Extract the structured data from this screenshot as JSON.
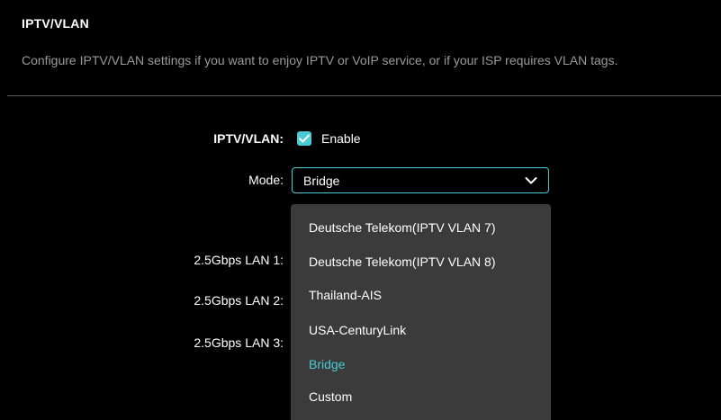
{
  "section": {
    "title": "IPTV/VLAN",
    "description": "Configure IPTV/VLAN settings if you want to enjoy IPTV or VoIP service, or if your ISP requires VLAN tags."
  },
  "form": {
    "iptv_label": "IPTV/VLAN:",
    "enable_label": "Enable",
    "enable_checked": true,
    "mode_label": "Mode:",
    "mode_value": "Bridge",
    "lan_labels": [
      "2.5Gbps LAN 1:",
      "2.5Gbps LAN 2:",
      "2.5Gbps LAN 3:"
    ]
  },
  "dropdown": {
    "options": [
      "Deutsche Telekom(IPTV VLAN 7)",
      "Deutsche Telekom(IPTV VLAN 8)",
      "Thailand-AIS",
      "USA-CenturyLink",
      "Bridge",
      "Custom"
    ],
    "selected": "Bridge"
  },
  "colors": {
    "accent": "#4acbd6",
    "background": "#000000",
    "dropdown_bg": "#3b3b3b",
    "muted_text": "#9a9a9a"
  },
  "icons": {
    "checkbox": "check-icon",
    "select": "chevron-down-icon"
  }
}
